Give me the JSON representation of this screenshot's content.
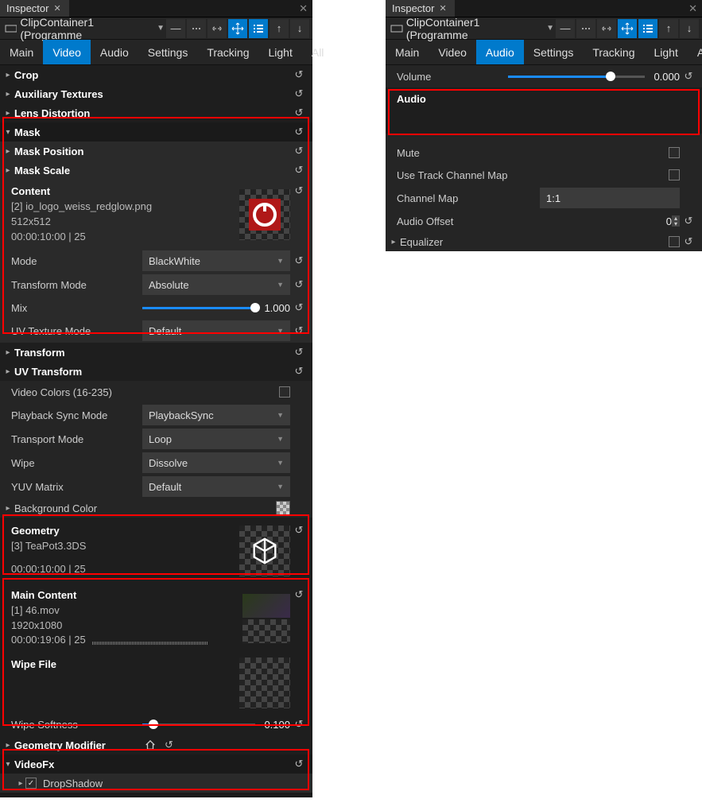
{
  "left": {
    "tab_title": "Inspector",
    "breadcrumb": "ClipContainer1 (Programme",
    "navtabs": [
      "Main",
      "Video",
      "Audio",
      "Settings",
      "Tracking",
      "Light",
      "All"
    ],
    "active_tab": "Video",
    "crop": "Crop",
    "aux": "Auxiliary Textures",
    "lens": "Lens Distortion",
    "mask": {
      "title": "Mask",
      "position": "Mask Position",
      "scale": "Mask Scale",
      "content_label": "Content",
      "content_ref": "[2] io_logo_weiss_redglow.png",
      "content_dims": "512x512",
      "content_tc": "00:00:10:00 | 25",
      "mode_label": "Mode",
      "mode_value": "BlackWhite",
      "tmode_label": "Transform Mode",
      "tmode_value": "Absolute",
      "mix_label": "Mix",
      "mix_value": "1.000",
      "uvtex_label": "UV Texture Mode",
      "uvtex_value": "Default"
    },
    "transform": "Transform",
    "uvtransform": "UV Transform",
    "vidcolors_label": "Video Colors (16-235)",
    "pbsync_label": "Playback Sync Mode",
    "pbsync_value": "PlaybackSync",
    "transport_label": "Transport Mode",
    "transport_value": "Loop",
    "wipe_label": "Wipe",
    "wipe_value": "Dissolve",
    "yuv_label": "YUV Matrix",
    "yuv_value": "Default",
    "bgcolor_label": "Background Color",
    "geometry": {
      "title": "Geometry",
      "ref": "[3] TeaPot3.3DS",
      "tc": "00:00:10:00 | 25"
    },
    "main_content": {
      "title": "Main Content",
      "ref": "[1] 46.mov",
      "dims": "1920x1080",
      "tc": "00:00:19:06 | 25",
      "wipefile_label": "Wipe File",
      "wipesoft_label": "Wipe Softness",
      "wipesoft_value": "0.100"
    },
    "geommod_label": "Geometry Modifier",
    "videofx_label": "VideoFx",
    "dropshadow_label": "DropShadow"
  },
  "right": {
    "tab_title": "Inspector",
    "breadcrumb": "ClipContainer1 (Programme",
    "navtabs": [
      "Main",
      "Video",
      "Audio",
      "Settings",
      "Tracking",
      "Light",
      "All"
    ],
    "active_tab": "Audio",
    "volume_label": "Volume",
    "volume_value": "0.000",
    "audio_label": "Audio",
    "mute_label": "Mute",
    "trackmap_label": "Use Track Channel Map",
    "chmap_label": "Channel Map",
    "chmap_value": "1:1",
    "offset_label": "Audio Offset",
    "offset_value": "0",
    "eq_label": "Equalizer"
  }
}
